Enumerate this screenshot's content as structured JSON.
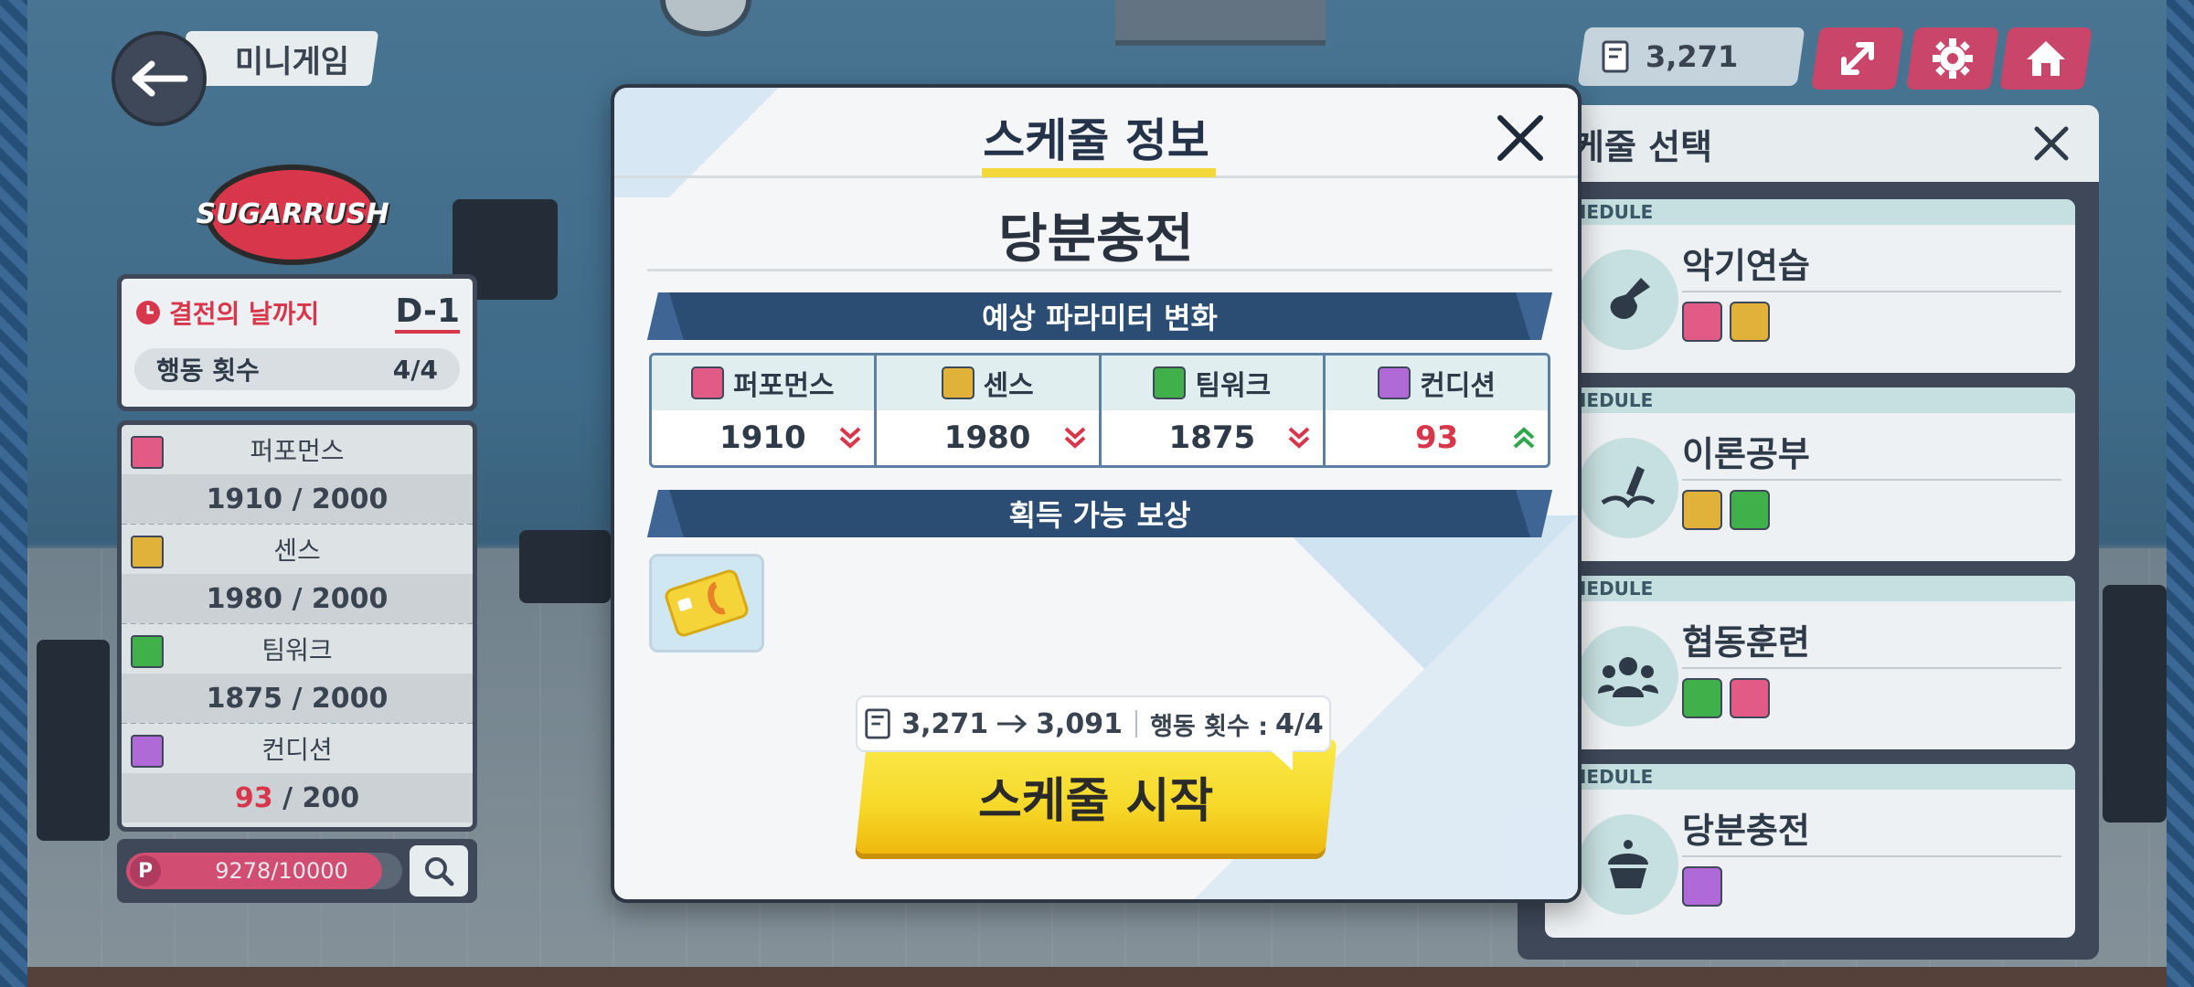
{
  "top_left": {
    "minigame_label": "미니게임"
  },
  "logo": {
    "line1": "SUGAR",
    "line2": "RUSH"
  },
  "status": {
    "dday_label": "결전의 날까지",
    "dday_value": "D-1",
    "actions_label": "행동 횟수",
    "actions_value": "4/4",
    "stats": [
      {
        "name": "퍼포먼스",
        "current": "1910",
        "max": "/ 2000",
        "icon": "microphone-icon",
        "color": "#e25a86"
      },
      {
        "name": "센스",
        "current": "1980",
        "max": "/ 2000",
        "icon": "sense-icon",
        "color": "#e0b23a"
      },
      {
        "name": "팀워크",
        "current": "1875",
        "max": "/ 2000",
        "icon": "team-icon",
        "color": "#3fb04a"
      },
      {
        "name": "컨디션",
        "current": "93",
        "max": "/ 200",
        "icon": "condition-icon",
        "color": "#b06ad8"
      }
    ],
    "points_text": "9278/10000",
    "points_fraction": 0.9278,
    "points_symbol": "P"
  },
  "top_right": {
    "currency_value": "3,271"
  },
  "schedule_panel": {
    "title": "케줄 선택",
    "cards": [
      {
        "tag": "CHEDULE",
        "name": "악기연습",
        "icon": "guitar-icon"
      },
      {
        "tag": "CHEDULE",
        "name": "이론공부",
        "icon": "book-pen-icon"
      },
      {
        "tag": "CHEDULE",
        "name": "협동훈련",
        "icon": "group-icon"
      },
      {
        "tag": "CHEDULE",
        "name": "당분충전",
        "icon": "cupcake-icon"
      }
    ]
  },
  "modal": {
    "title": "스케줄 정보",
    "schedule_name": "당분충전",
    "params_header": "예상 파라미터 변화",
    "params": [
      {
        "name": "퍼포먼스",
        "value": "1910",
        "trend": "down",
        "color": "#e25a86"
      },
      {
        "name": "센스",
        "value": "1980",
        "trend": "down",
        "color": "#e0b23a"
      },
      {
        "name": "팀워크",
        "value": "1875",
        "trend": "down",
        "color": "#3fb04a"
      },
      {
        "name": "컨디션",
        "value": "93",
        "trend": "up",
        "color": "#b06ad8"
      }
    ],
    "rewards_header": "획득 가능 보상",
    "cost_from": "3,271",
    "cost_to": "3,091",
    "actions_label": "행동 횟수 :",
    "actions_value": "4/4",
    "start_label": "스케줄 시작"
  },
  "colors": {
    "accent_yellow": "#f6d829",
    "navy": "#2b4c73",
    "red": "#d8374b",
    "pink_button": "#c9456a"
  }
}
